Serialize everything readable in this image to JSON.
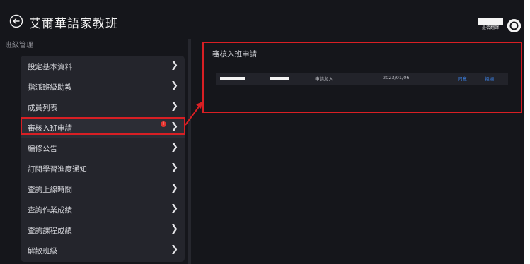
{
  "header": {
    "title": "艾爾華語家教班",
    "language_label": "是否翻譯"
  },
  "sidebar": {
    "caption": "班級管理",
    "items": [
      {
        "label": "設定基本資料"
      },
      {
        "label": "指派班級助教"
      },
      {
        "label": "成員列表"
      },
      {
        "label": "審核入班申請",
        "badge": "!",
        "active": true
      },
      {
        "label": "編修公告"
      },
      {
        "label": "訂閱學習進度通知"
      },
      {
        "label": "查詢上線時間"
      },
      {
        "label": "查詢作業成績"
      },
      {
        "label": "查詢課程成績"
      },
      {
        "label": "解散班級"
      }
    ]
  },
  "main": {
    "title": "審核入班申請",
    "requests": [
      {
        "status": "申請加入",
        "date": "2023/01/06",
        "approve_label": "同意",
        "reject_label": "拒絕"
      }
    ]
  },
  "colors": {
    "background": "#15161b",
    "panel": "#24252c",
    "highlight": "#d81f24",
    "link": "#3c7fe0",
    "badge": "#e2332f"
  },
  "icons": [
    "back-arrow-icon",
    "chevron-right-icon",
    "support-agent-icon",
    "notification-dot-icon"
  ]
}
